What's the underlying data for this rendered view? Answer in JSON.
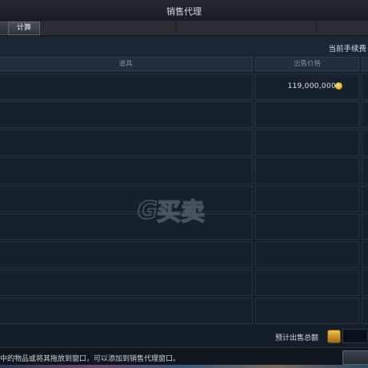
{
  "window": {
    "title": "销售代理"
  },
  "tabs": {
    "calc_label": "计算"
  },
  "fee": {
    "label": "当前手续费"
  },
  "table": {
    "col_item": "道具",
    "col_price": "出售价格",
    "rows": [
      {
        "item": "",
        "price": "119,000,000",
        "currency_icon": "gold-coin-icon"
      },
      {
        "item": "",
        "price": ""
      },
      {
        "item": "",
        "price": ""
      },
      {
        "item": "",
        "price": ""
      },
      {
        "item": "",
        "price": ""
      },
      {
        "item": "",
        "price": ""
      },
      {
        "item": "",
        "price": ""
      },
      {
        "item": "",
        "price": ""
      },
      {
        "item": "",
        "price": ""
      }
    ]
  },
  "total": {
    "label": "预计出售总额",
    "value": ""
  },
  "hint": {
    "text": "中的物品或将其拖放到窗口，可以添加到销售代理窗口。"
  },
  "colors": {
    "background": "#141e29",
    "gold": "#d9a50d"
  }
}
